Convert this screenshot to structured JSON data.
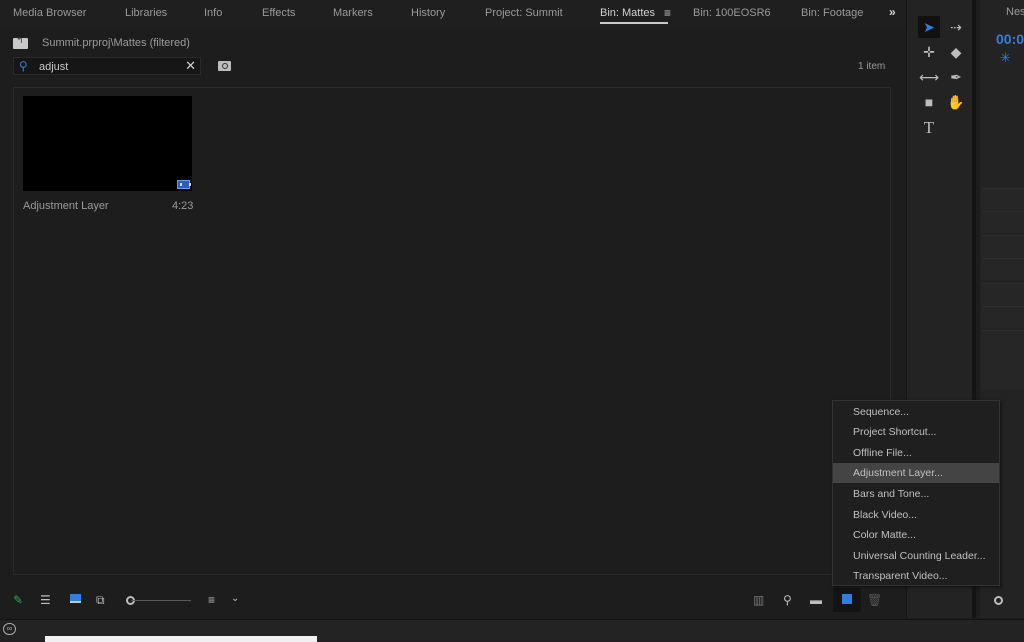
{
  "tabs": [
    {
      "label": "Media Browser"
    },
    {
      "label": "Libraries"
    },
    {
      "label": "Info"
    },
    {
      "label": "Effects"
    },
    {
      "label": "Markers"
    },
    {
      "label": "History"
    },
    {
      "label": "Project: Summit"
    },
    {
      "label": "Bin: Mattes",
      "active": true
    },
    {
      "label": "Bin: 100EOSR6"
    },
    {
      "label": "Bin: Footage"
    }
  ],
  "tab_menu_icon": "≡",
  "overflow_icon": "»",
  "project": {
    "path": "Summit.prproj\\Mattes (filtered)",
    "search_value": "adjust",
    "search_placeholder": "",
    "item_count": "1 item",
    "items": [
      {
        "name": "Adjustment Layer",
        "duration": "4:23"
      }
    ]
  },
  "tools": [
    {
      "name": "selection-tool",
      "glyph": "➤"
    },
    {
      "name": "track-select-forward-tool",
      "glyph": "⇢"
    },
    {
      "name": "ripple-edit-tool",
      "glyph": "✛"
    },
    {
      "name": "razor-tool",
      "glyph": "◆"
    },
    {
      "name": "slip-tool",
      "glyph": "⟷"
    },
    {
      "name": "pen-tool",
      "glyph": "✒"
    },
    {
      "name": "rectangle-tool",
      "glyph": "■"
    },
    {
      "name": "hand-tool",
      "glyph": "✋"
    },
    {
      "name": "type-tool",
      "glyph": "T"
    }
  ],
  "timeline": {
    "title": "Nes",
    "timecode": "00:0",
    "snap_icon": "✳"
  },
  "context_menu": {
    "items": [
      {
        "label": "Sequence..."
      },
      {
        "label": "Project Shortcut..."
      },
      {
        "label": "Offline File..."
      },
      {
        "label": "Adjustment Layer...",
        "highlighted": true
      },
      {
        "label": "Bars and Tone..."
      },
      {
        "label": "Black Video..."
      },
      {
        "label": "Color Matte..."
      },
      {
        "label": "Universal Counting Leader..."
      },
      {
        "label": "Transparent Video..."
      }
    ]
  },
  "colors": {
    "accent": "#2f7ee0",
    "pencil": "#2fa84a",
    "menu_highlight": "#444444"
  }
}
